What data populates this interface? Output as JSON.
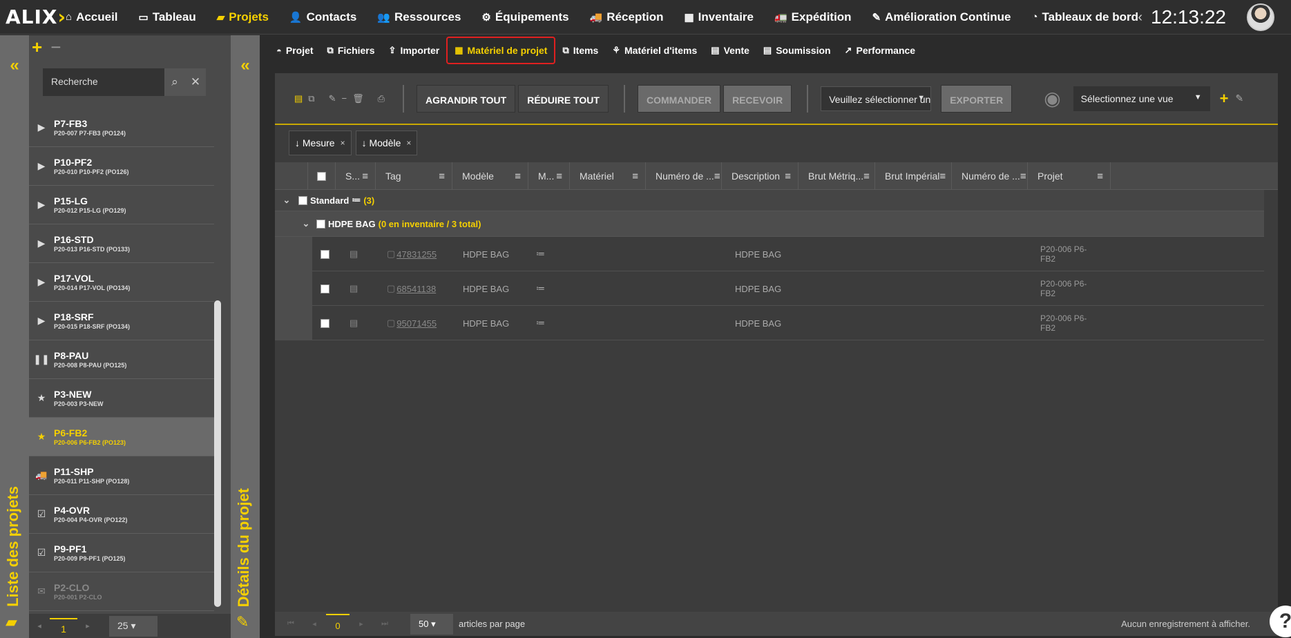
{
  "app": {
    "logo_text": "ALIX"
  },
  "nav": [
    {
      "icon": "⌂",
      "label": "Accueil"
    },
    {
      "icon": "▭",
      "label": "Tableau"
    },
    {
      "icon": "▰",
      "label": "Projets"
    },
    {
      "icon": "👤",
      "label": "Contacts"
    },
    {
      "icon": "👥",
      "label": "Ressources"
    },
    {
      "icon": "⚙",
      "label": "Équipements"
    },
    {
      "icon": "🚚",
      "label": "Réception"
    },
    {
      "icon": "▦",
      "label": "Inventaire"
    },
    {
      "icon": "🚛",
      "label": "Expédition"
    },
    {
      "icon": "✎",
      "label": "Amélioration Continue"
    },
    {
      "icon": "◔",
      "label": "Tableaux de bord"
    }
  ],
  "clock": "12:13:22",
  "left_panel": {
    "title": "Liste des projets",
    "search_placeholder": "Recherche",
    "items": [
      {
        "name": "P7-FB3",
        "sub": "P20-007 P7-FB3 (PO124)",
        "icon": "▶"
      },
      {
        "name": "P10-PF2",
        "sub": "P20-010 P10-PF2 (PO126)",
        "icon": "▶"
      },
      {
        "name": "P15-LG",
        "sub": "P20-012 P15-LG (PO129)",
        "icon": "▶"
      },
      {
        "name": "P16-STD",
        "sub": "P20-013 P16-STD (PO133)",
        "icon": "▶"
      },
      {
        "name": "P17-VOL",
        "sub": "P20-014 P17-VOL (PO134)",
        "icon": "▶"
      },
      {
        "name": "P18-SRF",
        "sub": "P20-015 P18-SRF (PO134)",
        "icon": "▶"
      },
      {
        "name": "P8-PAU",
        "sub": "P20-008 P8-PAU (PO125)",
        "icon": "❚❚"
      },
      {
        "name": "P3-NEW",
        "sub": "P20-003 P3-NEW",
        "icon": "★"
      },
      {
        "name": "P6-FB2",
        "sub": "P20-006 P6-FB2 (PO123)",
        "icon": "★"
      },
      {
        "name": "P11-SHP",
        "sub": "P20-011 P11-SHP (PO128)",
        "icon": "🚚"
      },
      {
        "name": "P4-OVR",
        "sub": "P20-004 P4-OVR (PO122)",
        "icon": "☑"
      },
      {
        "name": "P9-PF1",
        "sub": "P20-009 P9-PF1 (PO125)",
        "icon": "☑"
      },
      {
        "name": "P2-CLO",
        "sub": "P20-001 P2-CLO",
        "icon": "✉"
      }
    ],
    "pager": {
      "current": "1",
      "page_size": "25"
    }
  },
  "mid_panel": {
    "title": "Détails du projet"
  },
  "tabs": [
    {
      "icon": "◓",
      "label": "Projet"
    },
    {
      "icon": "⧉",
      "label": "Fichiers"
    },
    {
      "icon": "⇪",
      "label": "Importer"
    },
    {
      "icon": "▦",
      "label": "Matériel de projet"
    },
    {
      "icon": "⧉",
      "label": "Items"
    },
    {
      "icon": "⚘",
      "label": "Matériel d'items"
    },
    {
      "icon": "▤",
      "label": "Vente"
    },
    {
      "icon": "▤",
      "label": "Soumission"
    },
    {
      "icon": "↗",
      "label": "Performance"
    }
  ],
  "toolbar": {
    "expand_all": "AGRANDIR TOUT",
    "collapse_all": "RÉDUIRE TOUT",
    "order": "COMMANDER",
    "receive": "RECEVOIR",
    "select_placeholder": "Veuillez sélectionner un",
    "export": "EXPORTER",
    "view_placeholder": "Sélectionnez une vue"
  },
  "group_chips": [
    "↓ Mesure",
    "↓ Modèle"
  ],
  "columns": [
    "S...",
    "Tag",
    "Modèle",
    "M...",
    "Matériel",
    "Numéro de ...",
    "Description",
    "Brut Métriq...",
    "Brut Impérial",
    "Numéro de ...",
    "Projet"
  ],
  "group1": {
    "label": "Standard",
    "count": "(3)"
  },
  "group2": {
    "label": "HDPE BAG",
    "count": "(0 en inventaire / 3 total)"
  },
  "rows": [
    {
      "tag": "47831255",
      "model": "HDPE BAG",
      "description": "HDPE BAG",
      "project_line1": "P20-006 P6-",
      "project_line2": "FB2"
    },
    {
      "tag": "68541138",
      "model": "HDPE BAG",
      "description": "HDPE BAG",
      "project_line1": "P20-006 P6-",
      "project_line2": "FB2"
    },
    {
      "tag": "95071455",
      "model": "HDPE BAG",
      "description": "HDPE BAG",
      "project_line1": "P20-006 P6-",
      "project_line2": "FB2"
    }
  ],
  "footer": {
    "current_page": "0",
    "page_size": "50",
    "per_page_label": "articles par page",
    "no_records": "Aucun enregistrement à afficher."
  },
  "colors": {
    "accent": "#f5d000",
    "active_tab_border": "#e02020"
  }
}
